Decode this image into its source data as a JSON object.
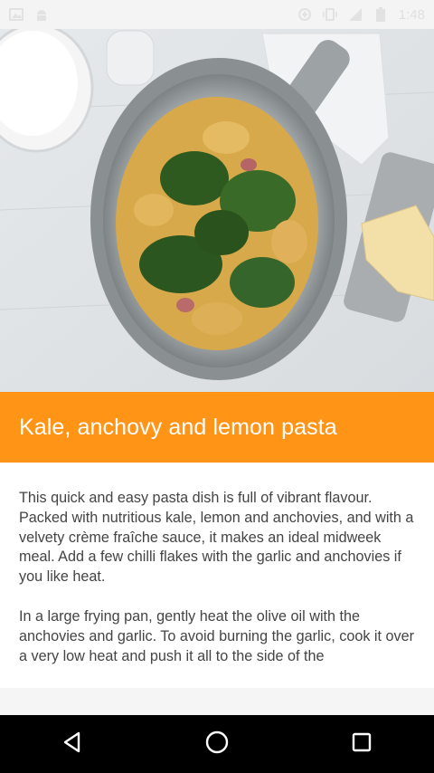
{
  "status_bar": {
    "time": "1:48",
    "icons": [
      "image-icon",
      "android-icon",
      "data-saver-icon",
      "vibrate-icon",
      "signal-icon",
      "battery-icon"
    ]
  },
  "recipe": {
    "title": "Kale, anchovy and lemon pasta",
    "paragraphs": [
      "This quick and easy pasta dish is full of vibrant flavour. Packed with nutritious kale, lemon and anchovies, and with a velvety crème fraîche sauce, it makes an ideal midweek meal. Add a few chilli flakes with the garlic and anchovies if you like heat.",
      "In a large frying pan, gently heat the olive oil with the anchovies and garlic. To avoid burning the garlic, cook it over a very low heat and push it all to the side of the"
    ]
  },
  "nav_bar": {
    "buttons": [
      "back-icon",
      "home-icon",
      "recents-icon"
    ]
  },
  "colors": {
    "accent": "#ff9417",
    "nav_bg": "#000000",
    "status_bg": "#f4f4f4",
    "body_text": "#444444"
  }
}
